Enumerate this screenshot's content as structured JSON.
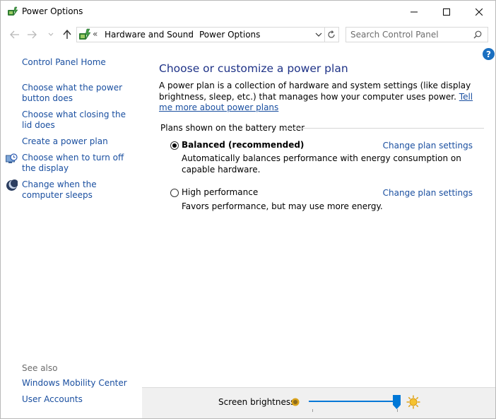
{
  "window": {
    "title": "Power Options",
    "controls": {
      "minimize": "minimize-icon",
      "maximize": "maximize-icon",
      "close": "close-icon"
    }
  },
  "navigation": {
    "back_icon": "arrow-left-icon",
    "forward_icon": "arrow-right-icon",
    "recent_icon": "chevron-down-icon",
    "up_icon": "arrow-up-icon"
  },
  "address": {
    "overflow": "«",
    "crumbs": [
      "Hardware and Sound",
      "Power Options"
    ],
    "separator": "›"
  },
  "search": {
    "placeholder": "Search Control Panel",
    "value": ""
  },
  "help": {
    "label": "?"
  },
  "left_pane": {
    "home": "Control Panel Home",
    "links": [
      {
        "label": "Choose what the power button does",
        "icon": ""
      },
      {
        "label": "Choose what closing the lid does",
        "icon": ""
      },
      {
        "label": "Create a power plan",
        "icon": ""
      },
      {
        "label": "Choose when to turn off the display",
        "icon": "display-clock-icon"
      },
      {
        "label": "Change when the computer sleeps",
        "icon": "moon-icon"
      }
    ],
    "see_also_label": "See also",
    "see_also": [
      "Windows Mobility Center",
      "User Accounts"
    ]
  },
  "main": {
    "title": "Choose or customize a power plan",
    "description": "A power plan is a collection of hardware and system settings (like display brightness, sleep, etc.) that manages how your computer uses power.",
    "learn_more": "Tell me more about power plans",
    "section_label": "Plans shown on the battery meter",
    "plans": [
      {
        "name": "Balanced (recommended)",
        "description": "Automatically balances performance with energy consumption on capable hardware.",
        "selected": true,
        "link": "Change plan settings"
      },
      {
        "name": "High performance",
        "description": "Favors performance, but may use more energy.",
        "selected": false,
        "link": "Change plan settings"
      }
    ]
  },
  "bottom": {
    "brightness_label": "Screen brightness:",
    "brightness_value": 0.96,
    "dim_icon": "dim-sun-icon",
    "bright_icon": "bright-sun-icon",
    "accent": "#0078d7"
  },
  "colors": {
    "link": "#1a4fa0",
    "title": "#1e3287",
    "help": "#1a6fc0"
  }
}
